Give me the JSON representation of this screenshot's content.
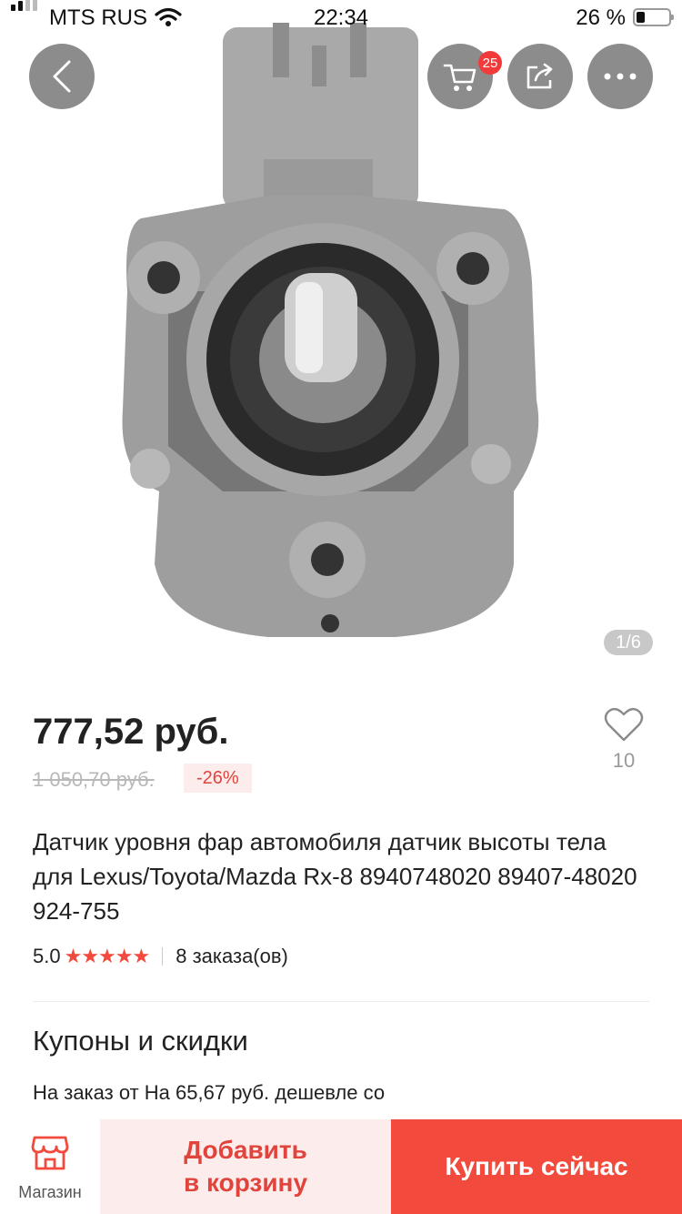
{
  "status_bar": {
    "carrier": "MTS RUS",
    "time": "22:34",
    "battery_text": "26 %",
    "battery_level": 0.26
  },
  "header": {
    "cart_badge": "25"
  },
  "gallery": {
    "pager": "1/6"
  },
  "product": {
    "price": "777,52 руб.",
    "old_price": "1 050,70 руб.",
    "discount": "-26%",
    "wishlist_count": "10",
    "title": "Датчик уровня фар автомобиля датчик высоты тела для Lexus/Toyota/Mazda Rx-8 8940748020 89407-48020 924-755",
    "rating": "5.0",
    "stars": "★★★★★",
    "orders": "8 заказа(ов)"
  },
  "coupons": {
    "title": "Купоны и скидки",
    "text": "На заказ от На 65,67 руб. дешевле со"
  },
  "bottom_bar": {
    "store_label": "Магазин",
    "add_to_cart": "Добавить в корзину",
    "buy_now": "Купить сейчас"
  },
  "colors": {
    "accent": "#f24a3c",
    "accent_light": "#fdecec",
    "muted": "#b8b8b8"
  }
}
